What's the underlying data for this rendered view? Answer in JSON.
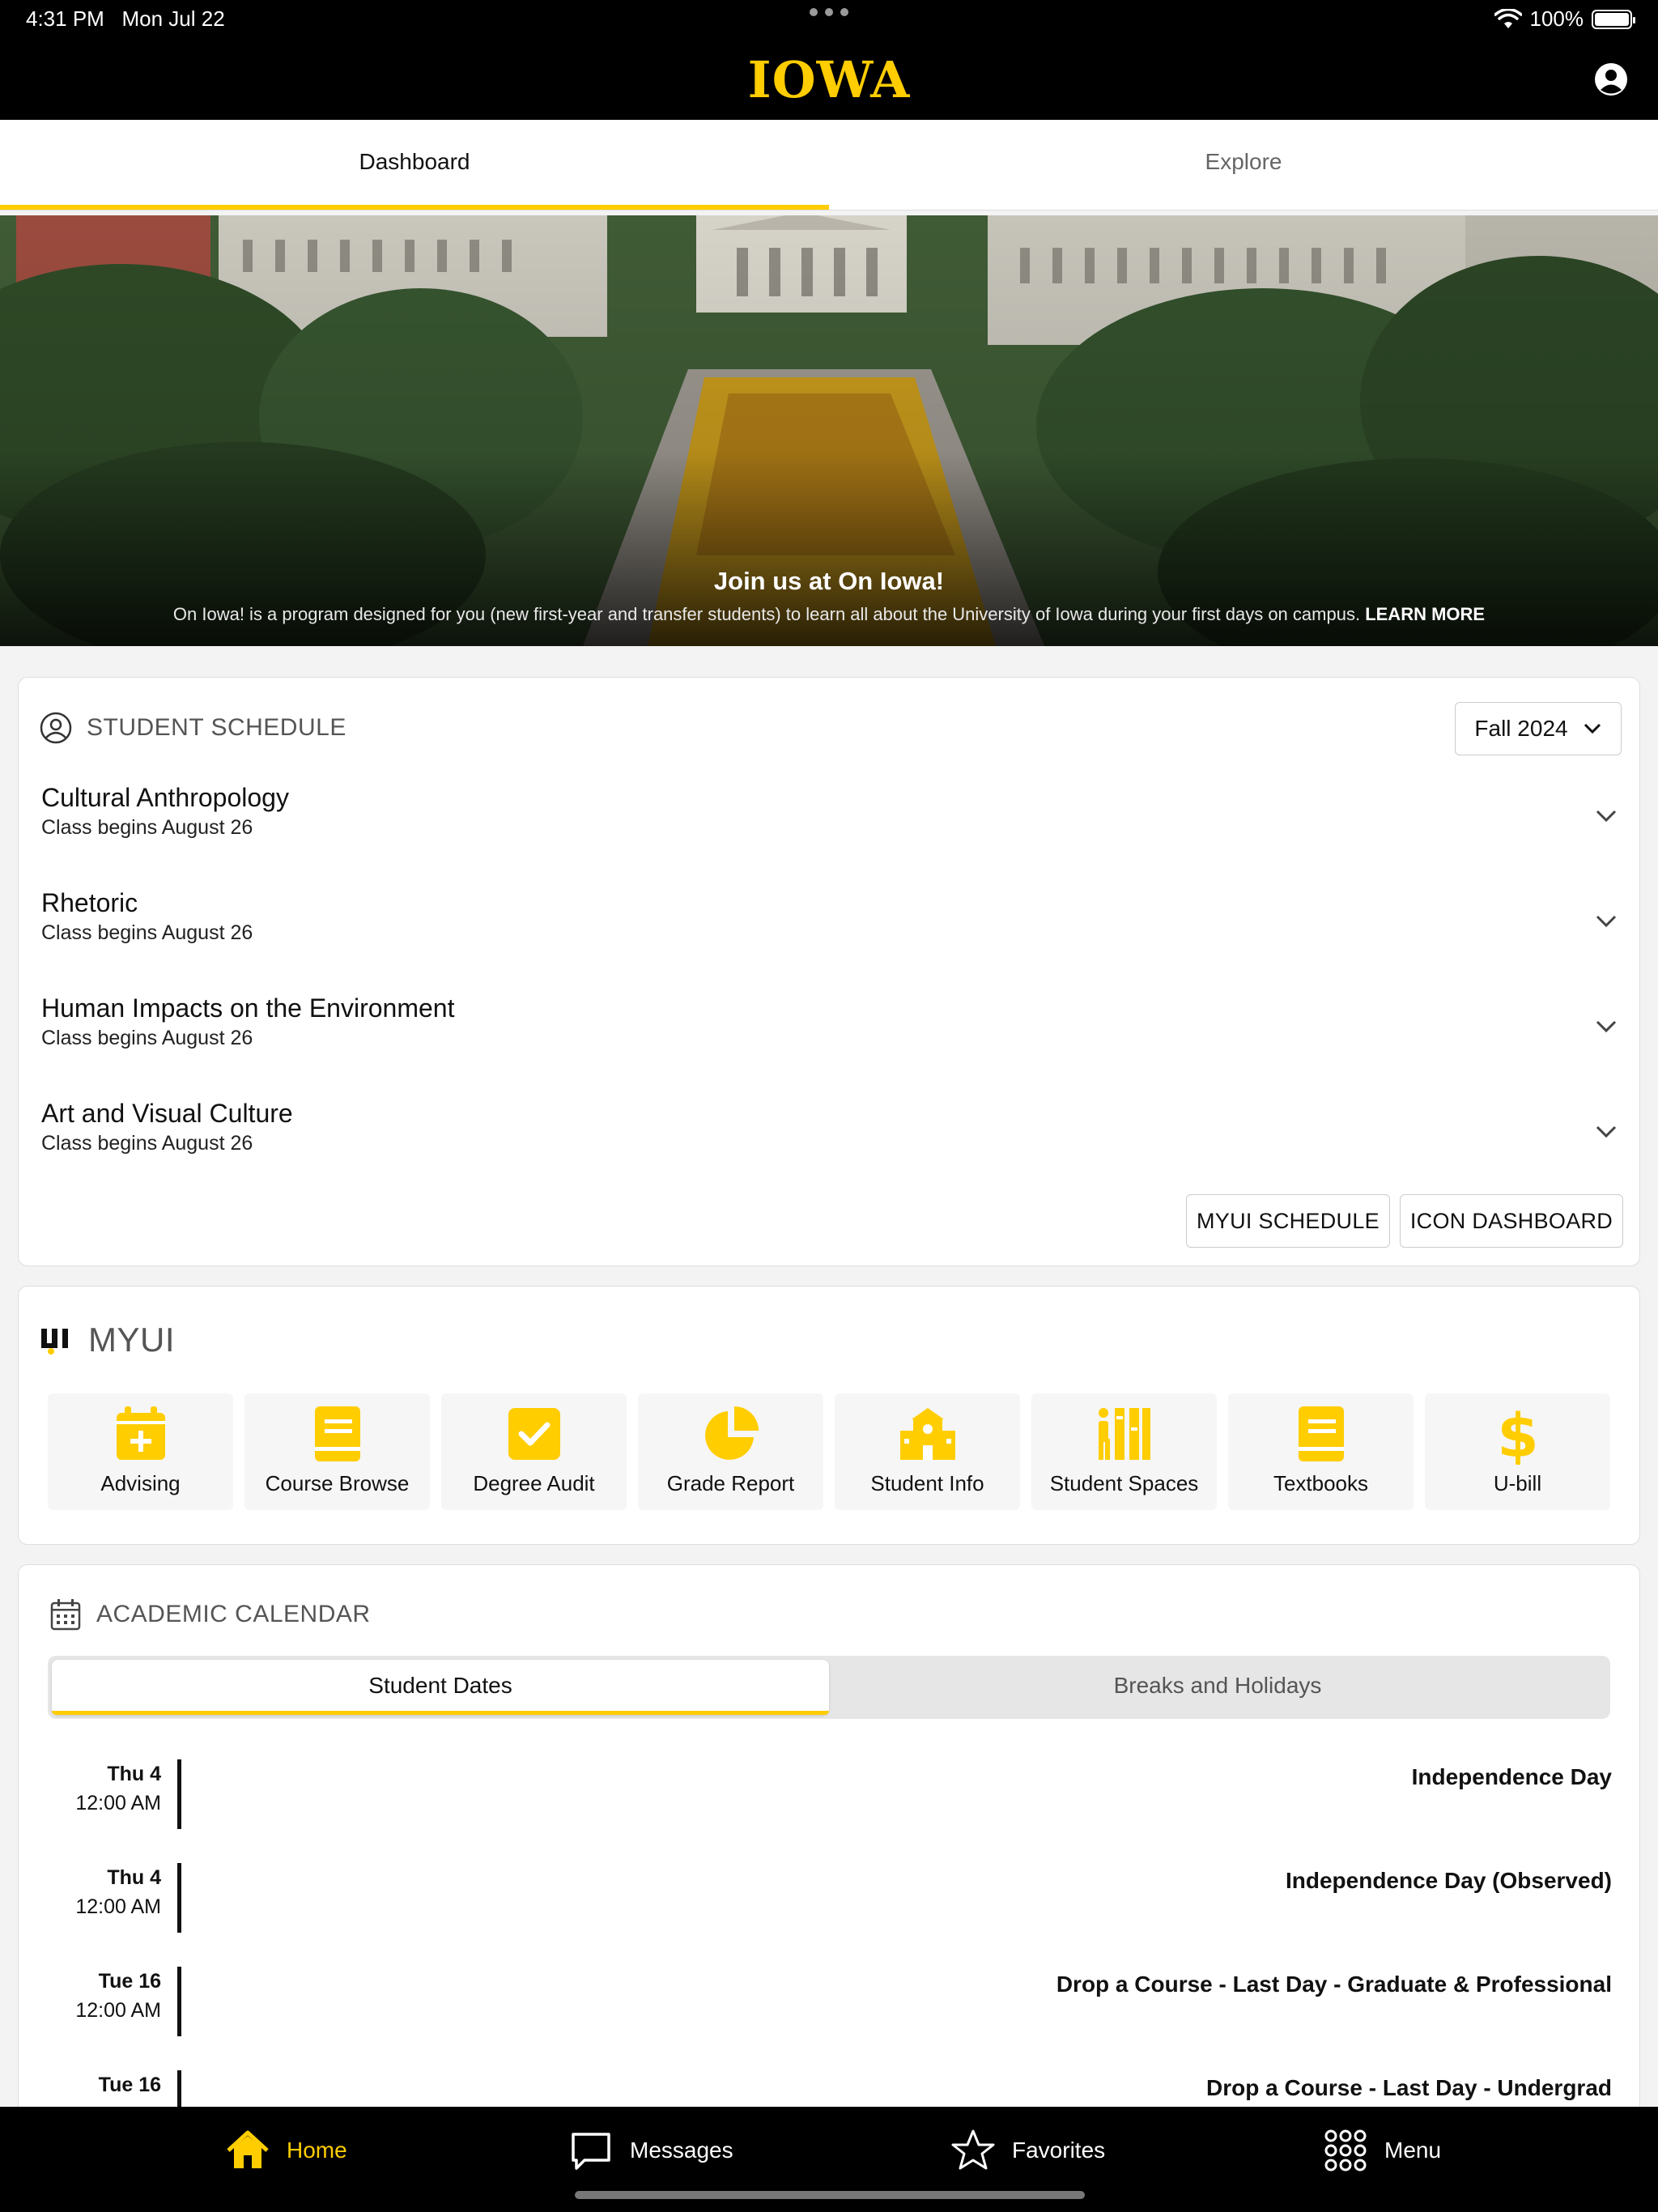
{
  "status": {
    "time": "4:31 PM",
    "date": "Mon Jul 22",
    "battery": "100%"
  },
  "header": {
    "logo": "IOWA"
  },
  "tabs": [
    {
      "label": "Dashboard",
      "active": true
    },
    {
      "label": "Explore",
      "active": false
    }
  ],
  "hero": {
    "title": "Join us at On Iowa!",
    "description": "On Iowa! is a program designed for you (new first-year and transfer students) to learn all about the University of Iowa during your first days on campus.",
    "link": "LEARN MORE"
  },
  "schedule": {
    "title": "STUDENT SCHEDULE",
    "term": "Fall 2024",
    "courses": [
      {
        "name": "Cultural Anthropology",
        "sub": "Class begins August 26"
      },
      {
        "name": "Rhetoric",
        "sub": "Class begins August 26"
      },
      {
        "name": "Human Impacts on the Environment",
        "sub": "Class begins August 26"
      },
      {
        "name": "Art and Visual Culture",
        "sub": "Class begins August 26"
      }
    ],
    "buttons": {
      "myui": "MYUI SCHEDULE",
      "icon": "ICON DASHBOARD"
    }
  },
  "myui": {
    "title": "MYUI",
    "tiles": [
      {
        "label": "Advising",
        "icon": "calendar-plus-icon"
      },
      {
        "label": "Course Browse",
        "icon": "book-icon"
      },
      {
        "label": "Degree Audit",
        "icon": "checkbox-icon"
      },
      {
        "label": "Grade Report",
        "icon": "pie-chart-icon"
      },
      {
        "label": "Student Info",
        "icon": "school-icon"
      },
      {
        "label": "Student Spaces",
        "icon": "spaces-icon"
      },
      {
        "label": "Textbooks",
        "icon": "textbook-icon"
      },
      {
        "label": "U-bill",
        "icon": "dollar-icon"
      }
    ]
  },
  "calendar": {
    "title": "ACADEMIC CALENDAR",
    "segments": [
      {
        "label": "Student Dates",
        "active": true
      },
      {
        "label": "Breaks and Holidays",
        "active": false
      }
    ],
    "events": [
      {
        "day": "Thu 4",
        "time": "12:00 AM",
        "title": "Independence Day"
      },
      {
        "day": "Thu 4",
        "time": "12:00 AM",
        "title": "Independence Day (Observed)"
      },
      {
        "day": "Tue 16",
        "time": "12:00 AM",
        "title": "Drop a Course - Last Day - Graduate & Professional"
      },
      {
        "day": "Tue 16",
        "time": "",
        "title": "Drop a Course - Last Day - Undergrad"
      }
    ]
  },
  "bottomnav": [
    {
      "label": "Home",
      "active": true
    },
    {
      "label": "Messages",
      "active": false
    },
    {
      "label": "Favorites",
      "active": false
    },
    {
      "label": "Menu",
      "active": false
    }
  ],
  "colors": {
    "gold": "#ffcd00",
    "black": "#000000"
  }
}
